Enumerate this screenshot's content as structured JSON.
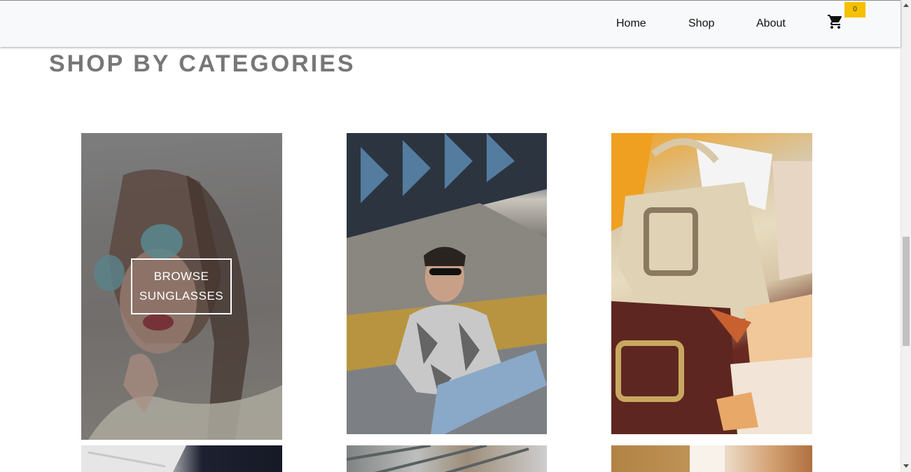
{
  "nav": {
    "home": "Home",
    "shop": "Shop",
    "about": "About",
    "cart_count": "0"
  },
  "main": {
    "section_title": "SHOP BY CATEGORIES",
    "categories": [
      {
        "browse_line1": "BROWSE",
        "browse_line2": "SUNGLASSES"
      }
    ]
  },
  "colors": {
    "navbar_bg": "#f8f9fa",
    "badge": "#f5c000",
    "title": "#777777"
  }
}
